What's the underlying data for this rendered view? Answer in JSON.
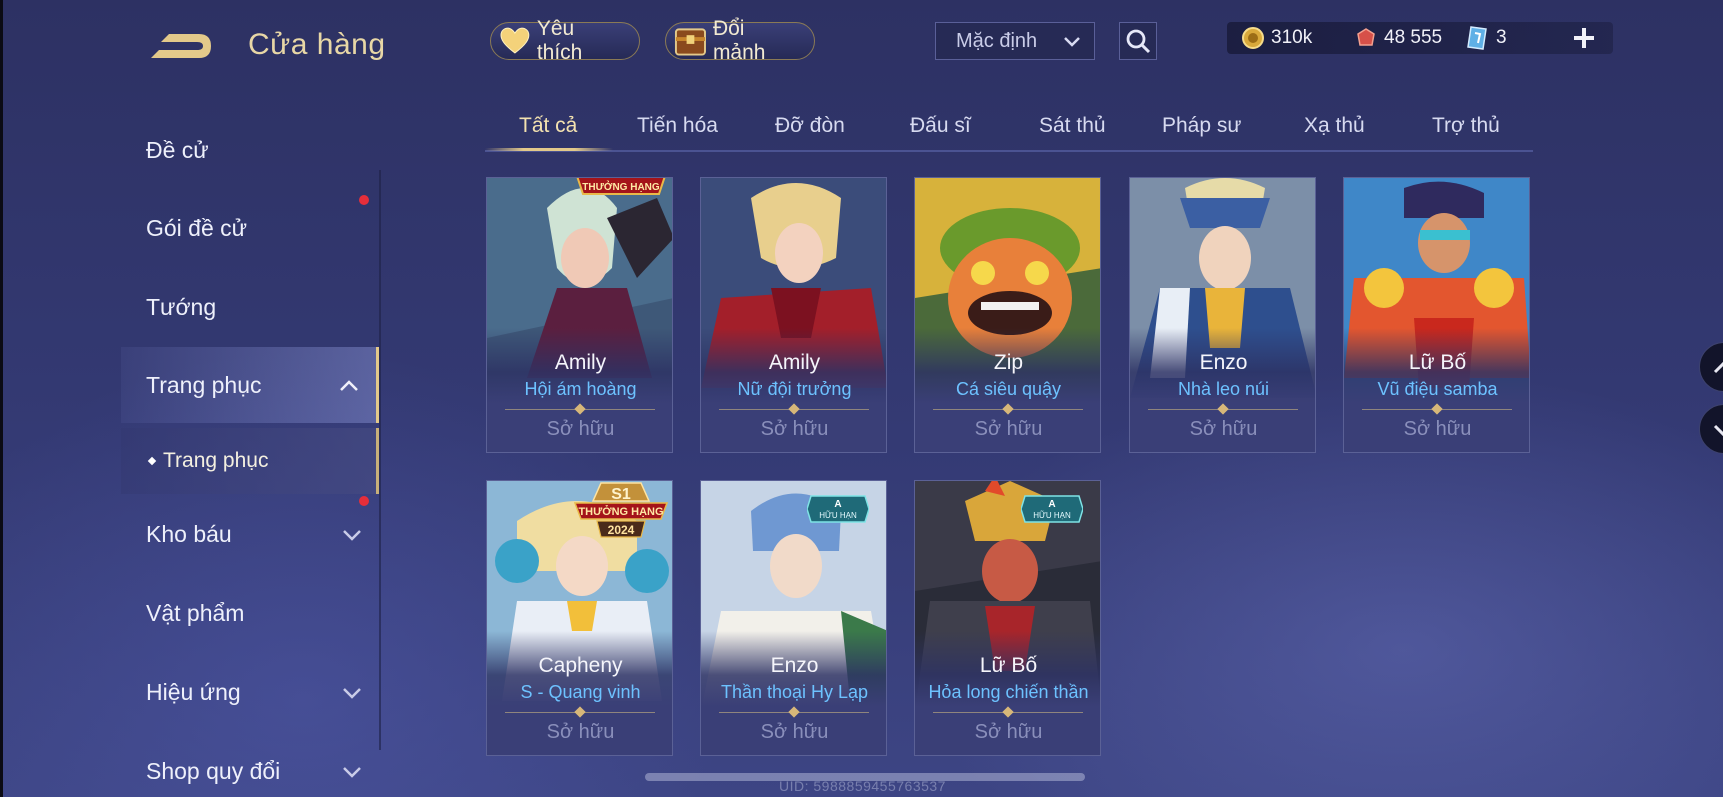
{
  "header": {
    "title": "Cửa hàng",
    "favorite_label": "Yêu thích",
    "fragment_label": "Đổi mảnh",
    "sort_value": "Mặc định",
    "currencies": {
      "gold": "310k",
      "ruby": "48 555",
      "ticket": "3"
    }
  },
  "sidebar": {
    "items": [
      {
        "label": "Đề cử"
      },
      {
        "label": "Gói đề cử"
      },
      {
        "label": "Tướng"
      },
      {
        "label": "Trang phục"
      },
      {
        "label": "Kho báu"
      },
      {
        "label": "Vật phẩm"
      },
      {
        "label": "Hiệu ứng"
      },
      {
        "label": "Shop quy đổi"
      }
    ],
    "sub_item": "Trang phục"
  },
  "tabs": [
    "Tất cả",
    "Tiến hóa",
    "Đỡ đòn",
    "Đấu sĩ",
    "Sát thủ",
    "Pháp sư",
    "Xạ thủ",
    "Trợ thủ"
  ],
  "cards": [
    {
      "hero": "Amily",
      "skin": "Hội ám hoàng",
      "status": "Sở hữu",
      "badge": "THƯỞNG HẠNG"
    },
    {
      "hero": "Amily",
      "skin": "Nữ đội trưởng",
      "status": "Sở hữu"
    },
    {
      "hero": "Zip",
      "skin": "Cá siêu quậy",
      "status": "Sở hữu"
    },
    {
      "hero": "Enzo",
      "skin": "Nhà leo núi",
      "status": "Sở hữu"
    },
    {
      "hero": "Lữ Bố",
      "skin": "Vũ điệu samba",
      "status": "Sở hữu"
    },
    {
      "hero": "Capheny",
      "skin": "S - Quang vinh",
      "status": "Sở hữu",
      "badge": "S1 THƯỞNG HẠNG 2024"
    },
    {
      "hero": "Enzo",
      "skin": "Thần thoại Hy Lạp",
      "status": "Sở hữu",
      "badge": "A HỮU HẠN"
    },
    {
      "hero": "Lữ Bố",
      "skin": "Hỏa long chiến thần",
      "status": "Sở hữu",
      "badge": "A HỮU HẠN"
    }
  ],
  "badges": {
    "rank_small": "THƯỞNG HẠNG",
    "rank_s1": "S1",
    "rank_label": "THƯỞNG HẠNG",
    "rank_year": "2024",
    "limited_grade": "A",
    "limited_label": "HỮU HẠN"
  },
  "uid": "UID: 5988859455763537",
  "colors": {
    "accent_gold": "#e3c98a",
    "skin_blue": "#6dc2ff",
    "notify_red": "#e52e3a"
  }
}
